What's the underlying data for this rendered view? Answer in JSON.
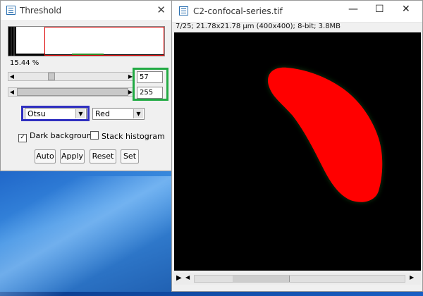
{
  "threshold_window": {
    "title": "Threshold",
    "close_glyph": "✕",
    "percent": "15.44 %",
    "lower_value": "57",
    "upper_value": "255",
    "method": "Otsu",
    "display_mode": "Red",
    "dark_background_label": "Dark background",
    "dark_background_checked": true,
    "stack_histogram_label": "Stack histogram",
    "stack_histogram_checked": false,
    "buttons": {
      "auto": "Auto",
      "apply": "Apply",
      "reset": "Reset",
      "set": "Set"
    }
  },
  "image_window": {
    "title": "C2-confocal-series.tif",
    "minimize_glyph": "—",
    "maximize_glyph": "☐",
    "close_glyph": "✕",
    "info": "7/25; 21.78x21.78 µm (400x400); 8-bit; 3.8MB",
    "slice": 7,
    "slice_count": 25
  },
  "colors": {
    "highlight_green": "#22aa44",
    "highlight_blue": "#3030c0",
    "threshold_red": "#ff0000"
  }
}
